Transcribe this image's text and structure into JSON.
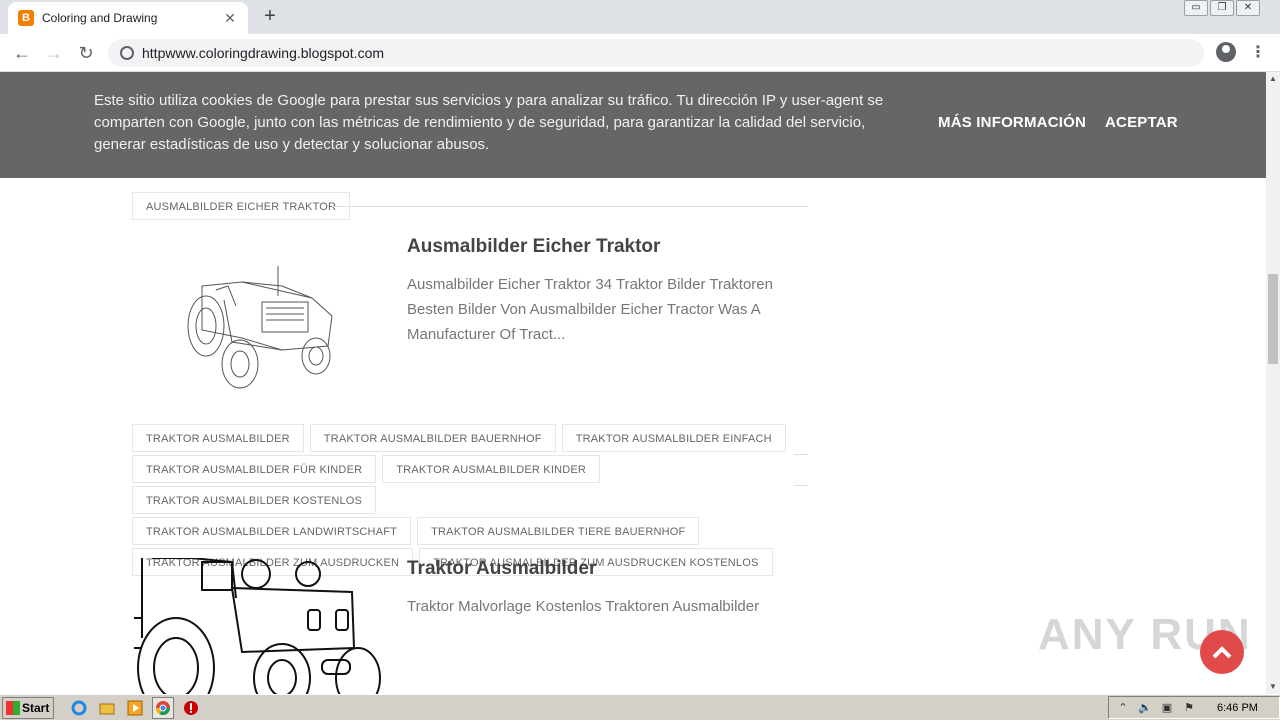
{
  "browser": {
    "tab_title": "Coloring and Drawing",
    "tab_close": "✕",
    "new_tab": "+",
    "url": "httpwww.coloringdrawing.blogspot.com",
    "window_controls": [
      "▭",
      "❐",
      "✕"
    ]
  },
  "cookie_banner": {
    "message": "Este sitio utiliza cookies de Google para prestar sus servicios y para analizar su tráfico. Tu dirección IP y user-agent se comparten con Google, junto con las métricas de rendimiento y de seguridad, para garantizar la calidad del servicio, generar estadísticas de uso y detectar y solucionar abusos.",
    "more_info": "MÁS INFORMACIÓN",
    "accept": "ACEPTAR"
  },
  "posts": [
    {
      "label": "AUSMALBILDER EICHER TRAKTOR",
      "title": "Ausmalbilder Eicher Traktor",
      "snippet": "Ausmalbilder Eicher Traktor 34 Traktor Bilder Traktoren Besten Bilder Von Ausmalbilder Eicher Tractor Was A Manufacturer Of Tract..."
    },
    {
      "title": "Traktor Ausmalbilder",
      "snippet": "Traktor Malvorlage Kostenlos Traktoren Ausmalbilder"
    }
  ],
  "tags": [
    "TRAKTOR AUSMALBILDER",
    "TRAKTOR AUSMALBILDER BAUERNHOF",
    "TRAKTOR AUSMALBILDER EINFACH",
    "TRAKTOR AUSMALBILDER FÜR KINDER",
    "TRAKTOR AUSMALBILDER KINDER",
    "TRAKTOR AUSMALBILDER KOSTENLOS",
    "TRAKTOR AUSMALBILDER LANDWIRTSCHAFT",
    "TRAKTOR AUSMALBILDER TIERE BAUERNHOF",
    "TRAKTOR AUSMALBILDER ZUM AUSDRUCKEN",
    "TRAKTOR AUSMALBILDER ZUM AUSDRUCKEN KOSTENLOS"
  ],
  "watermark": "ANY RUN",
  "taskbar": {
    "start": "Start",
    "quicklaunch": [
      "ie-icon",
      "folder-icon",
      "media-player-icon",
      "chrome-icon",
      "stop-icon"
    ],
    "clock": "6:46 PM"
  },
  "colors": {
    "cookie_bg": "#666666",
    "accent_red": "#e14a4a",
    "tab_strip": "#dee1e6"
  }
}
